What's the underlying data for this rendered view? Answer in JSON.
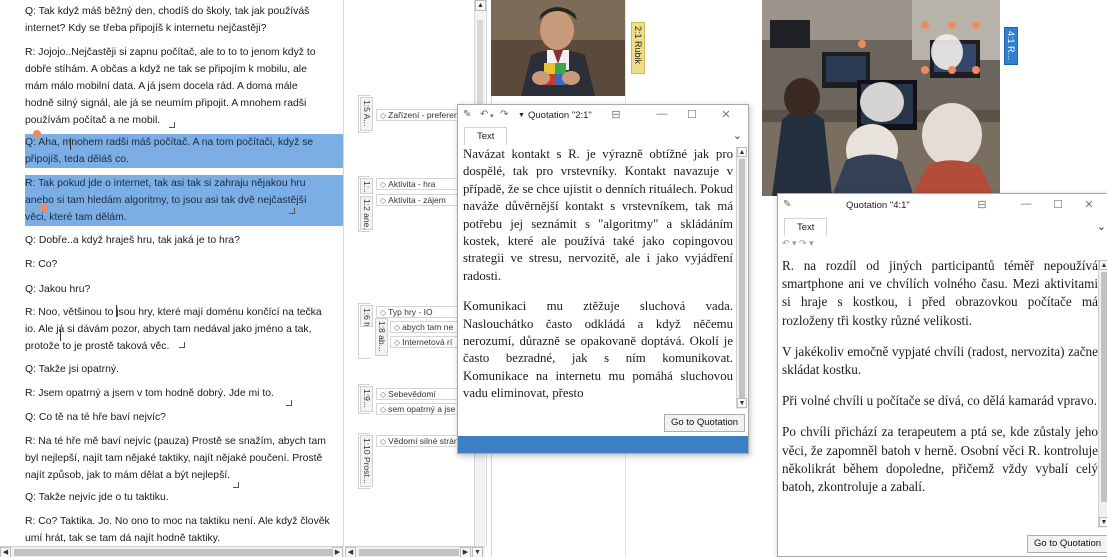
{
  "document": {
    "paragraphs": [
      "Q: Tak když máš běžný den, chodíš do školy, tak jak používáš\ninternet? Kdy se třeba připojíš k internetu nejčastěji?",
      "R: Jojojo..Nejčastěji si zapnu počítač, ale to to to jenom když to\ndobře stíhám. A občas a když ne tak se připojím k mobilu, ale\nmám málo mobilní data. A já jsem docela rád. A doma mále\nhodně silný signál, ale já se neumím připojit. A mnohem radši\npoužívám počítač a ne mobil.",
      "Q: Aha, mnohem radši máš počítač. A na tom počítači, když se\npřipojíš, teda děláš co.",
      "R: Tak pokud jde o internet, tak asi tak si zahraju nějakou hru\nanebo si tam hledám algoritmy, to jsou asi tak dvě nejčastější\nvěci, které tam dělám.",
      "Q: Dobře..a když hraješ hru, tak jaká je to hra?",
      "R: Co?",
      "Q: Jakou hru?",
      "R: Noo, většinou to jsou hry, které mají doménu končící na tečka\nio. Ale já si dávám pozor, abych tam nedával jako jméno a tak,\nprotože to je prostě taková věc.",
      "Q: Takže jsi opatrný.",
      "R: Jsem opatrný a jsem v tom hodně dobrý. Jde mi to.",
      "Q: Co tě na té hře baví nejvíc?",
      "R: Na té hře mě baví nejvíc (pauza) Prostě se snažím, abych tam\nbyl nejlepší, najít tam nějaké taktiky, najít nějaké poučení. Prostě\nnajít způsob, jak to mám dělat a být nejlepší.",
      "Q: Takže nejvíc jde o tu taktiku.",
      "R: Co? Taktika. Jo. No ono to moc na taktiku není. Ale když člověk\numí hrát, tak se tam dá najít hodně taktiky."
    ]
  },
  "margin": {
    "labels": [
      "1:5 A...",
      "1:...",
      "1:2 ane...",
      "1:6 h...",
      "1:8 ab...",
      "1:9...",
      "1:10 Prost..."
    ],
    "codes": [
      "Zařízení - preferen",
      "Aktivita - hra",
      "Aktivita - zájem",
      "Typ hry - IO",
      "abych tam ne",
      "Internetová rí",
      "Sebevědomí",
      "sem opatrný a jse",
      "Vědomí silné strán"
    ]
  },
  "image_tabs": {
    "tab_21": "2:1 Rubik",
    "tab_41": "4:1 R..."
  },
  "popup1": {
    "title": "Quotation \"2:1\"",
    "tab": "Text",
    "paragraphs": [
      "Navázat kontakt s R. je výrazně obtížné jak pro dospělé, tak pro vrstevníky. Kontakt navazuje v případě, že se chce ujistit o denních rituálech. Pokud naváže důvěrnější kontakt s vrstevníkem, tak má potřebu jej seznámit s \"algoritmy\" a skládáním kostek, které ale používá také jako copingovou strategii ve stresu, nervozitě, ale i jako vyjádření radosti.",
      "Komunikaci mu ztěžuje sluchová vada. Naslouchátko často odkládá a když něčemu nerozumí, důrazně se opakovaně doptává. Okolí je často bezradné, jak s ním komunikovat. Komunikace na internetu mu pomáhá sluchovou vadu eliminovat, přesto"
    ],
    "button": "Go to Quotation"
  },
  "popup2": {
    "title": "Quotation \"4:1\"",
    "tab": "Text",
    "paragraphs": [
      "R. na rozdíl od jiných participantů téměř nepoužívá smartphone ani ve chvílích volného času. Mezi aktivitami si hraje s kostkou, i před obrazovkou počítače má rozloženy tři kostky různé velikosti.",
      "V jakékoliv emočně vypjaté chvíli (radost, nervozita) začne skládat kostku.",
      "Při volné chvíli u počítače se dívá, co dělá kamarád vpravo.",
      "Po chvíli přichází za terapeutem a ptá se, kde zůstaly jeho věci, že zapomněl batoh v herně. Osobní věci R. kontroluje několikrát během dopoledne, přičemž vždy vybalí celý batoh, zkontroluje a zabalí."
    ],
    "button": "Go to Quotation"
  },
  "colors": {
    "highlight": "#488fdb",
    "handle": "#f08a5d",
    "tab_yellow": "#eedc8a",
    "tab_blue": "#2f7fd3",
    "footer_blue": "#3b7fc4"
  }
}
